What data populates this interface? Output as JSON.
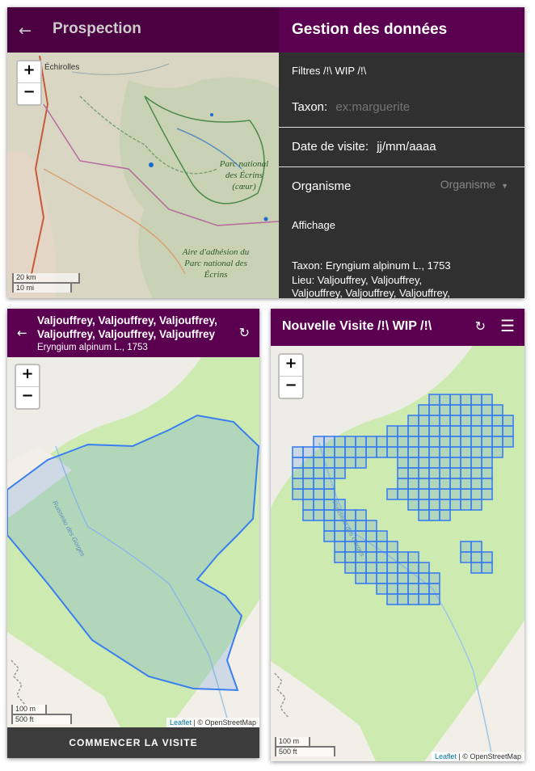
{
  "prospection": {
    "title": "Prospection",
    "map": {
      "city_label": "Échirolles",
      "park_label": "Parc national des Écrins (cœur)",
      "aire_label": "Aire d'adhésion du Parc national des Écrins",
      "scale_km": "20 km",
      "scale_mi": "10 mi"
    },
    "zoom_in": "+",
    "zoom_out": "−",
    "gestion": {
      "title": "Gestion des données",
      "filters_label": "Filtres /!\\ WIP /!\\",
      "taxon_label": "Taxon:",
      "taxon_placeholder": "ex:marguerite",
      "date_label": "Date de visite:",
      "date_value": "jj/mm/aaaa",
      "organisme_label": "Organisme",
      "organisme_placeholder": "Organisme",
      "affichage_label": "Affichage",
      "taxon_line": "Taxon: Eryngium alpinum L., 1753",
      "lieu_line1": "Lieu: Valjouffrey, Valjouffrey,",
      "lieu_line2": "Valjouffrey, Valjouffrey, Valjouffrey,"
    }
  },
  "site": {
    "title_line1": "Valjouffrey, Valjouffrey, Valjouffrey,",
    "title_line2": "Valjouffrey, Valjouffrey, Valjouffrey",
    "subtitle": "Eryngium alpinum L., 1753",
    "river_label": "Ruisseau des Gorges",
    "scale_m": "100 m",
    "scale_ft": "500 ft",
    "attrib_leaflet": "Leaflet",
    "attrib_osm": " | © OpenStreetMap",
    "start_button": "COMMENCER LA VISITE",
    "zoom_in": "+",
    "zoom_out": "−"
  },
  "visite": {
    "title": "Nouvelle Visite /!\\ WIP /!\\",
    "river_label": "Ruisseau des Gorges",
    "scale_m": "100 m",
    "scale_ft": "500 ft",
    "attrib_leaflet": "Leaflet",
    "attrib_osm": " | © OpenStreetMap",
    "zoom_in": "+",
    "zoom_out": "−"
  },
  "colors": {
    "header_dark": "#4a0041",
    "header_purple": "#5b0050",
    "sidebar": "#303030",
    "grid_blue": "#3a7ff0",
    "map_green": "#cdebb0"
  }
}
